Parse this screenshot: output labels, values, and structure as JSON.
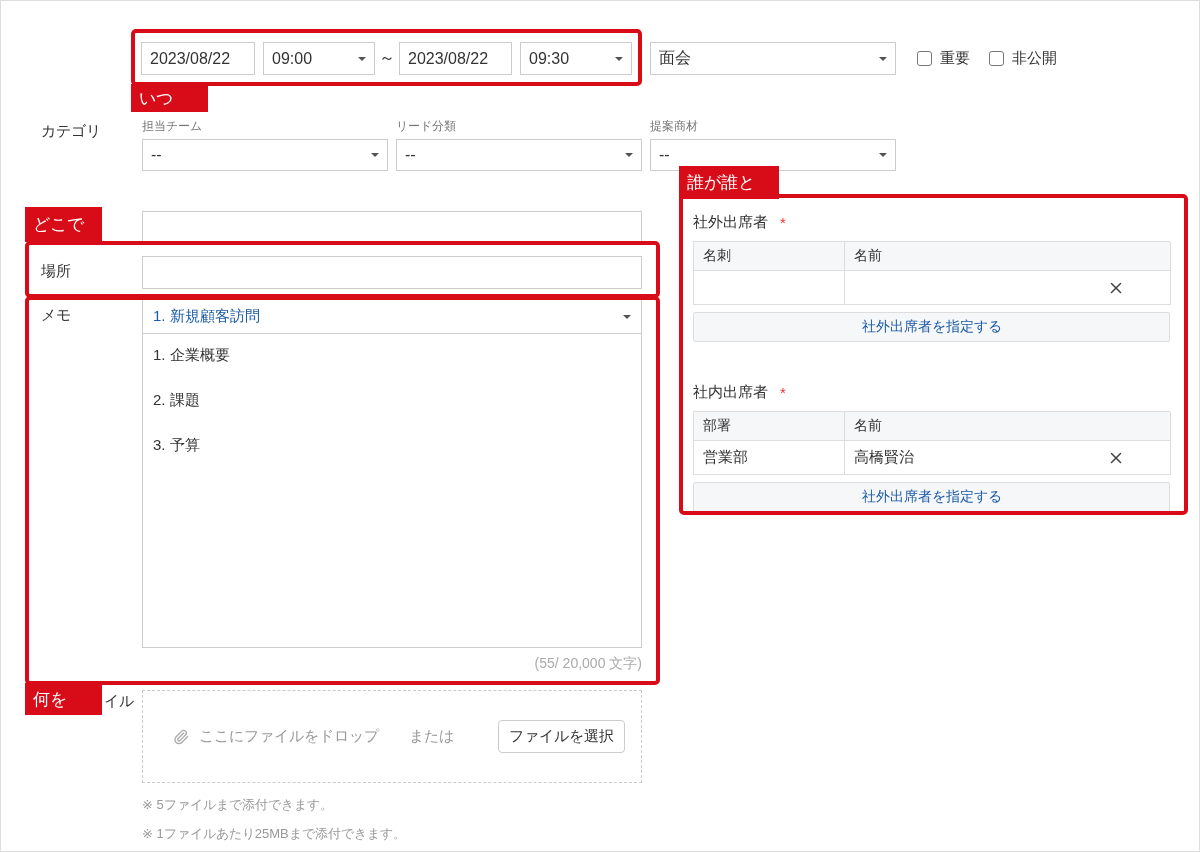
{
  "when": {
    "start_date": "2023/08/22",
    "start_time": "09:00",
    "separator": "～",
    "end_date": "2023/08/22",
    "end_time": "09:30"
  },
  "type_select": "面会",
  "checkboxes": [
    {
      "label": "重要",
      "checked": false
    },
    {
      "label": "非公開",
      "checked": false
    }
  ],
  "category": {
    "label": "カテゴリ",
    "fields": [
      {
        "label": "担当チーム",
        "value": "--"
      },
      {
        "label": "リード分類",
        "value": "--"
      },
      {
        "label": "提案商材",
        "value": "--"
      }
    ]
  },
  "place": {
    "label": "場所"
  },
  "memo": {
    "label": "メモ",
    "template": "1. 新規顧客訪問",
    "lines": [
      "1. 企業概要",
      "2. 課題",
      "3. 予算"
    ],
    "counter": "(55/ 20,000 文字)"
  },
  "file": {
    "label": "イル",
    "drop_text": "ここにファイルをドロップ",
    "or": "または",
    "button": "ファイルを選択",
    "notes": [
      "※ 5ファイルまで添付できます。",
      "※ 1ファイルあたり25MBまで添付できます。"
    ]
  },
  "attendees": [
    {
      "title": "社外出席者",
      "required_mark": "*",
      "columns": [
        "名刺",
        "名前"
      ],
      "rows": [
        {
          "cells": [
            null,
            null
          ]
        }
      ],
      "button": "社外出席者を指定する"
    },
    {
      "title": "社内出席者",
      "required_mark": "*",
      "columns": [
        "部署",
        "名前"
      ],
      "rows": [
        {
          "cells": [
            "営業部",
            "高橋賢治"
          ]
        }
      ],
      "button": "社外出席者を指定する"
    }
  ],
  "annotations": [
    {
      "label": "いつ"
    },
    {
      "label": "どこで"
    },
    {
      "label": "何を"
    },
    {
      "label": "誰が誰と"
    }
  ]
}
